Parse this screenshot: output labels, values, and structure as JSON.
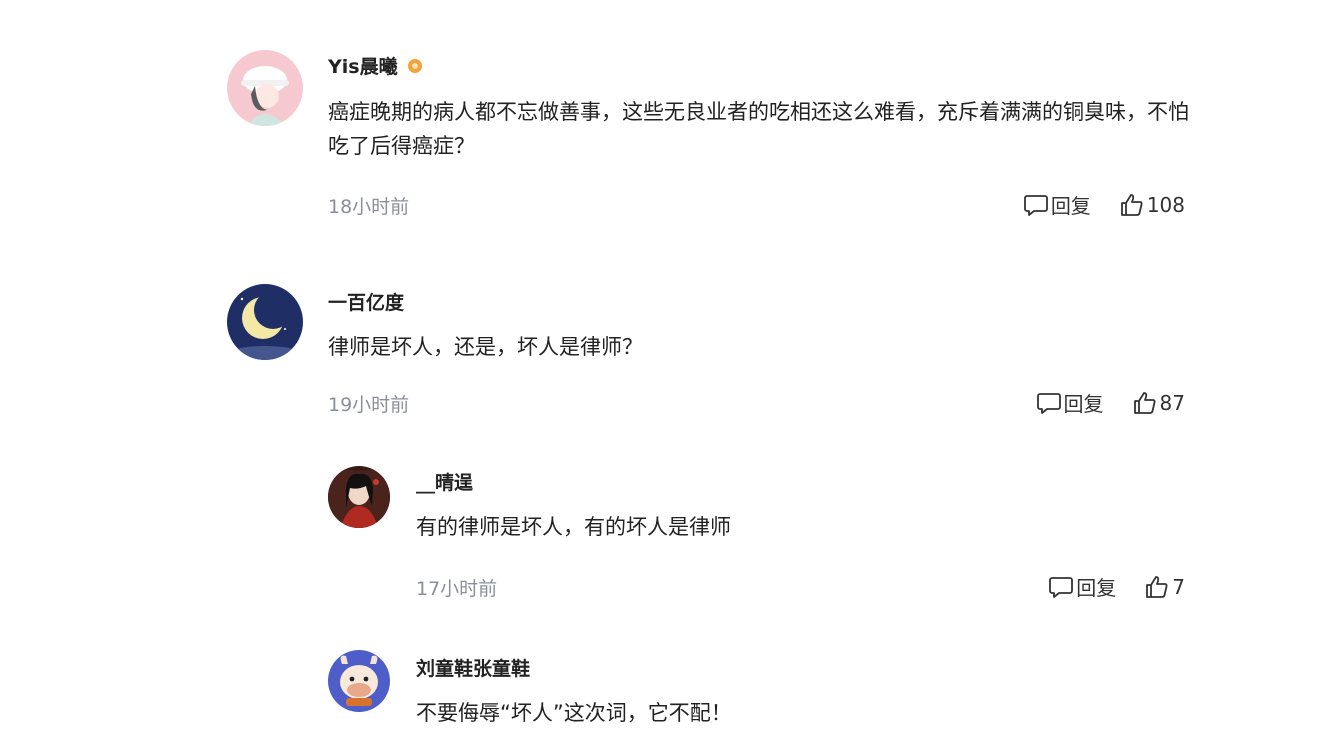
{
  "comments": [
    {
      "user": "Yis晨曦",
      "text": "癌症晚期的病人都不忘做善事，这些无良业者的吃相还这么难看，充斥着满满的铜臭味，不怕吃了后得癌症？",
      "time": "18小时前",
      "reply_label": "回复",
      "likes": "108",
      "verified_badge": "vip-badge-icon"
    },
    {
      "user": "一百亿度",
      "text": "律师是坏人，还是，坏人是律师？",
      "time": "19小时前",
      "reply_label": "回复",
      "likes": "87"
    }
  ],
  "replies": [
    {
      "user": "__晴逞",
      "text": "有的律师是坏人，有的坏人是律师",
      "time": "17小时前",
      "reply_label": "回复",
      "likes": "7"
    },
    {
      "user": "刘童鞋张童鞋",
      "text": "不要侮辱“坏人”这次词，它不配！"
    }
  ],
  "icons": {
    "reply": "comment-bubble-icon",
    "like": "thumbs-up-icon"
  },
  "colors": {
    "text": "#222222",
    "meta": "#8a8f99",
    "badge": "#f4a23a"
  }
}
